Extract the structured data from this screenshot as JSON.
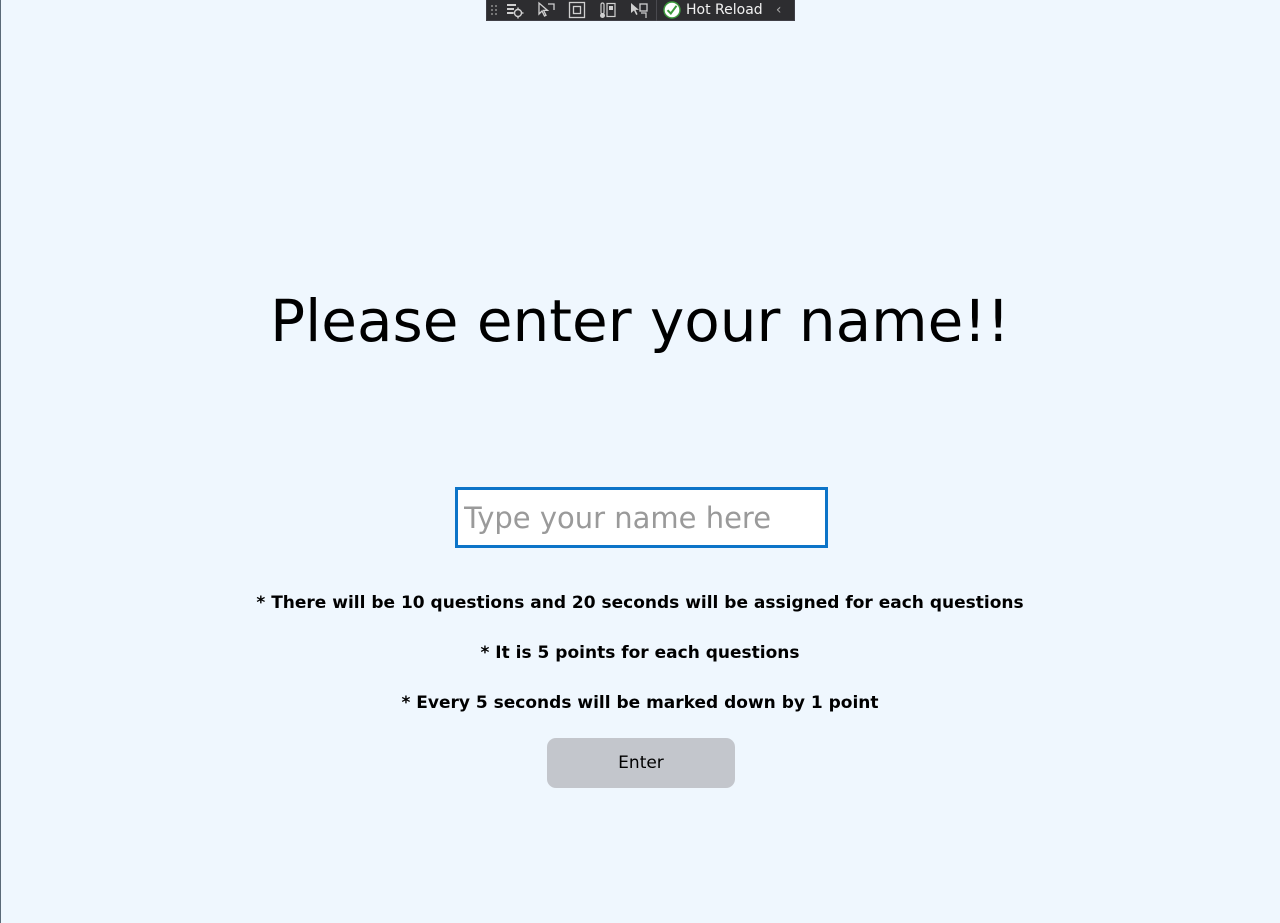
{
  "debug_toolbar": {
    "icons": [
      "live-visual-tree-icon",
      "select-element-icon",
      "display-layout-adorners-icon",
      "track-focus-icon",
      "select-pointer-icon"
    ],
    "hot_reload_label": "Hot Reload",
    "hot_reload_status": "ok",
    "collapse_glyph": "‹"
  },
  "page": {
    "title": "Please enter your name!!",
    "name_input": {
      "value": "",
      "placeholder": "Type your name here"
    },
    "rules": [
      "* There will be 10 questions and 20 seconds will be assigned for each questions",
      "* It is 5 points for each questions",
      "* Every 5 seconds will be marked down by 1 point"
    ],
    "enter_button_label": "Enter"
  },
  "colors": {
    "background": "#eff7fe",
    "input_focus_border": "#0c74c8",
    "button_background": "#c3c6cc",
    "toolbar_background": "#2d2d30"
  }
}
